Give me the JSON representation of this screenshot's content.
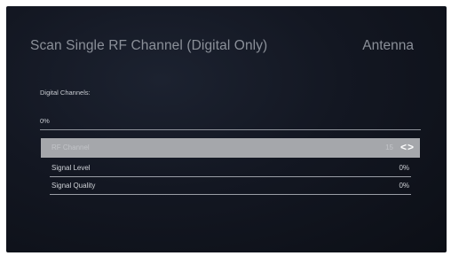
{
  "screen": {
    "title": "Scan Single RF Channel  (Digital Only)",
    "source": "Antenna"
  },
  "scan": {
    "digital_channels_label": "Digital Channels:",
    "progress_text": "0%",
    "progress_value": 0
  },
  "rows": [
    {
      "label": "RF Channel",
      "value": "15",
      "arrows": "<>"
    },
    {
      "label": "Signal Level",
      "value": "0%"
    },
    {
      "label": "Signal Quality",
      "value": "0%"
    }
  ]
}
